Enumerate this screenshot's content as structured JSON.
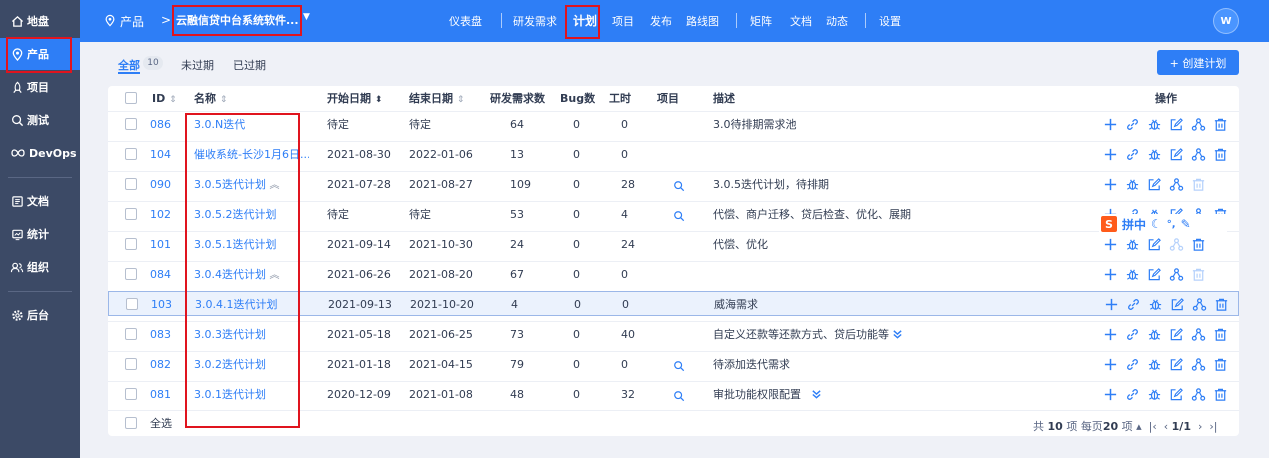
{
  "sidebar": {
    "items": [
      {
        "label": "地盘",
        "icon": "home-icon",
        "active": false
      },
      {
        "label": "产品",
        "icon": "product-pin-icon",
        "active": true
      },
      {
        "label": "项目",
        "icon": "project-icon",
        "active": false
      },
      {
        "label": "测试",
        "icon": "test-icon",
        "active": false
      },
      {
        "label": "DevOps",
        "icon": "devops-icon",
        "active": false
      },
      {
        "label": "文档",
        "icon": "doc-icon",
        "active": false
      },
      {
        "label": "统计",
        "icon": "stats-icon",
        "active": false
      },
      {
        "label": "组织",
        "icon": "org-icon",
        "active": false
      },
      {
        "label": "后台",
        "icon": "admin-gear-icon",
        "active": false
      }
    ]
  },
  "header": {
    "product_label": "产品",
    "breadcrumb_arrow": ">",
    "current_product": "云融信贷中台系统软件...",
    "nav": [
      "仪表盘",
      "研发需求",
      "计划",
      "项目",
      "发布",
      "路线图",
      "矩阵",
      "文档",
      "动态",
      "设置"
    ],
    "active_nav": "计划",
    "avatar": "W"
  },
  "filters": {
    "all": "全部",
    "count": "10",
    "unexpired": "未过期",
    "expired": "已过期"
  },
  "create_button": "+ 创建计划",
  "table": {
    "headers": {
      "id": "ID",
      "name": "名称",
      "start": "开始日期",
      "end": "结束日期",
      "stories": "研发需求数",
      "bugs": "Bug数",
      "hours": "工时",
      "project": "项目",
      "desc": "描述",
      "ops": "操作"
    },
    "rows": [
      {
        "id": "086",
        "name": "3.0.N迭代",
        "start": "待定",
        "end": "待定",
        "stories": "64",
        "bugs": "0",
        "hours": "0",
        "project": false,
        "desc": "3.0待排期需求池",
        "chevron": "",
        "collapse": false,
        "has_link": true,
        "selected": false
      },
      {
        "id": "104",
        "name": "催收系统-长沙1月6日...",
        "start": "2021-08-30",
        "end": "2022-01-06",
        "stories": "13",
        "bugs": "0",
        "hours": "0",
        "project": false,
        "desc": "",
        "chevron": "",
        "collapse": false,
        "has_link": true,
        "selected": false
      },
      {
        "id": "090",
        "name": "3.0.5迭代计划",
        "start": "2021-07-28",
        "end": "2021-08-27",
        "stories": "109",
        "bugs": "0",
        "hours": "28",
        "project": true,
        "desc": "3.0.5迭代计划，待排期",
        "chevron": "",
        "collapse": true,
        "has_link": false,
        "selected": false
      },
      {
        "id": "102",
        "name": "3.0.5.2迭代计划",
        "start": "待定",
        "end": "待定",
        "stories": "53",
        "bugs": "0",
        "hours": "4",
        "project": true,
        "desc": "代偿、商户迁移、贷后检查、优化、展期",
        "chevron": "",
        "collapse": false,
        "has_link": true,
        "selected": false
      },
      {
        "id": "101",
        "name": "3.0.5.1迭代计划",
        "start": "2021-09-14",
        "end": "2021-10-30",
        "stories": "24",
        "bugs": "0",
        "hours": "24",
        "project": false,
        "desc": "代偿、优化",
        "chevron": "",
        "collapse": false,
        "has_link": false,
        "selected": false
      },
      {
        "id": "084",
        "name": "3.0.4迭代计划",
        "start": "2021-06-26",
        "end": "2021-08-20",
        "stories": "67",
        "bugs": "0",
        "hours": "0",
        "project": false,
        "desc": "",
        "chevron": "",
        "collapse": true,
        "has_link": false,
        "selected": false
      },
      {
        "id": "103",
        "name": "3.0.4.1迭代计划",
        "start": "2021-09-13",
        "end": "2021-10-20",
        "stories": "4",
        "bugs": "0",
        "hours": "0",
        "project": false,
        "desc": "威海需求",
        "chevron": "",
        "collapse": false,
        "has_link": true,
        "selected": true
      },
      {
        "id": "083",
        "name": "3.0.3迭代计划",
        "start": "2021-05-18",
        "end": "2021-06-25",
        "stories": "73",
        "bugs": "0",
        "hours": "40",
        "project": false,
        "desc": "自定义还款等还款方式、贷后功能等",
        "chevron": "inline",
        "collapse": false,
        "has_link": true,
        "selected": false
      },
      {
        "id": "082",
        "name": "3.0.2迭代计划",
        "start": "2021-01-18",
        "end": "2021-04-15",
        "stories": "79",
        "bugs": "0",
        "hours": "0",
        "project": true,
        "desc": "待添加迭代需求",
        "chevron": "",
        "collapse": false,
        "has_link": true,
        "selected": false
      },
      {
        "id": "081",
        "name": "3.0.1迭代计划",
        "start": "2020-12-09",
        "end": "2021-01-08",
        "stories": "48",
        "bugs": "0",
        "hours": "32",
        "project": true,
        "desc": "审批功能权限配置",
        "chevron": "spaced",
        "collapse": false,
        "has_link": true,
        "selected": false
      }
    ]
  },
  "footer": {
    "select_all": "全选",
    "total_prefix": "共",
    "total": "10",
    "total_suffix": "项",
    "per_page_label": "每页",
    "per_page": "20",
    "per_page_suffix": "项",
    "page": "1/1"
  },
  "ime": {
    "logo": "S",
    "text": "拼中"
  },
  "colors": {
    "primary": "#2e7ef6",
    "sidebar": "#3c4a66",
    "highlight_red": "#e0141e"
  }
}
